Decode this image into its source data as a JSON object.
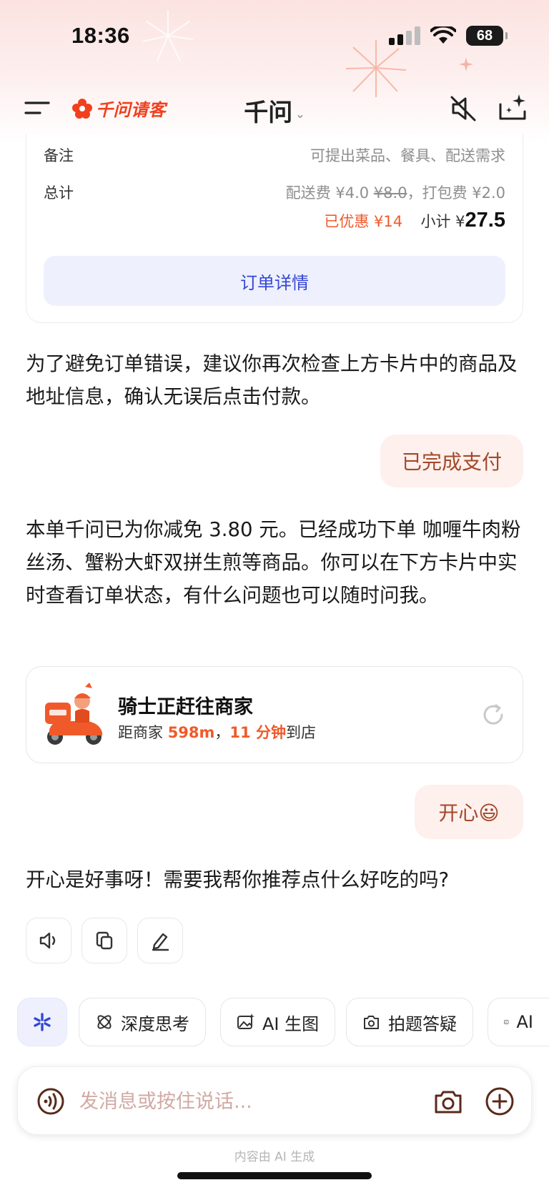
{
  "status_bar": {
    "time": "18:36",
    "battery": "68"
  },
  "nav": {
    "brand": "千问请客",
    "title": "千问",
    "title_chevron": "⌄"
  },
  "order_card": {
    "remark_label": "备注",
    "remark_value": "可提出菜品、餐具、配送需求",
    "total_label": "总计",
    "delivery_fee": "配送费 ¥4.0",
    "delivery_fee_original": "¥8.0",
    "packing_fee": "，打包费 ¥2.0",
    "discount": "已优惠 ¥14",
    "subtotal_label": "小计 ¥",
    "subtotal_value": "27.5",
    "details_button": "订单详情"
  },
  "messages": {
    "assistant_1": "为了避免订单错误，建议你再次检查上方卡片中的商品及地址信息，确认无误后点击付款。",
    "user_1": "已完成支付",
    "assistant_2": "本单千问已为你减免 3.80 元。已经成功下单 咖喱牛肉粉丝汤、蟹粉大虾双拼生煎等商品。你可以在下方卡片中实时查看订单状态，有什么问题也可以随时问我。",
    "user_2": "开心😃",
    "assistant_3": "开心是好事呀！需要我帮你推荐点什么好吃的吗?"
  },
  "rider_card": {
    "title": "骑士正赶往商家",
    "sub_prefix": "距商家 ",
    "distance": "598m",
    "sub_mid": "，",
    "eta": "11 分钟",
    "sub_suffix": "到店"
  },
  "chips": {
    "deep_think": "深度思考",
    "ai_image": "AI 生图",
    "photo_qa": "拍题答疑",
    "ai_more": "AI"
  },
  "input": {
    "placeholder": "发消息或按住说话..."
  },
  "footer_note": "内容由 AI 生成",
  "colors": {
    "accent_orange": "#f05a2a",
    "link_blue": "#3446d6",
    "user_bubble": "#fdf0ed"
  }
}
